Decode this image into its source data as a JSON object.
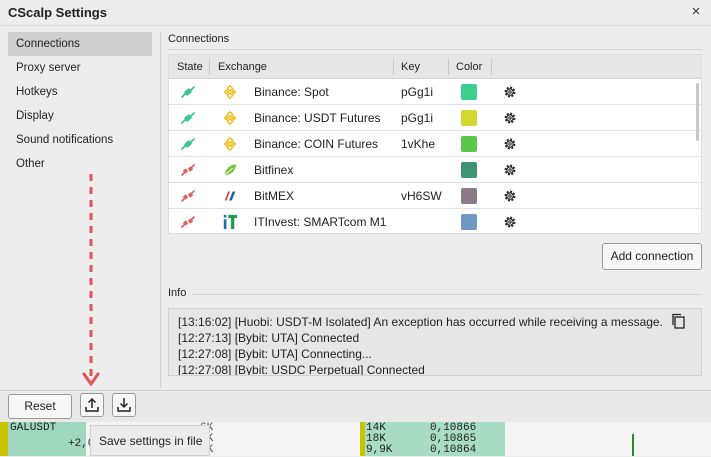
{
  "window": {
    "title": "CScalp Settings",
    "close_glyph": "×"
  },
  "sidebar": {
    "items": [
      {
        "label": "Connections",
        "active": true
      },
      {
        "label": "Proxy server",
        "active": false
      },
      {
        "label": "Hotkeys",
        "active": false
      },
      {
        "label": "Display",
        "active": false
      },
      {
        "label": "Sound notifications",
        "active": false
      },
      {
        "label": "Other",
        "active": false
      }
    ]
  },
  "connections": {
    "section_title": "Connections",
    "columns": [
      "State",
      "Exchange",
      "Key",
      "Color"
    ],
    "rows": [
      {
        "state": "connected",
        "exchange_icon": "binance-icon",
        "exchange": "Binance: Spot",
        "key": "pGg1i",
        "color": "#3cd08c"
      },
      {
        "state": "connected",
        "exchange_icon": "binance-icon",
        "exchange": "Binance: USDT Futures",
        "key": "pGg1i",
        "color": "#d6d632"
      },
      {
        "state": "connected",
        "exchange_icon": "binance-icon",
        "exchange": "Binance: COIN Futures",
        "key": "1vKhe",
        "color": "#56c846"
      },
      {
        "state": "disconnected",
        "exchange_icon": "bitfinex-leaf-icon",
        "exchange": "Bitfinex",
        "key": "",
        "color": "#3f9472"
      },
      {
        "state": "disconnected",
        "exchange_icon": "bitmex-icon",
        "exchange": "BitMEX",
        "key": "vH6SW",
        "color": "#8a7a88"
      },
      {
        "state": "disconnected",
        "exchange_icon": "itinvest-icon",
        "exchange": "ITInvest: SMARTcom M1",
        "key": "",
        "color": "#6f98c2"
      }
    ],
    "add_button_label": "Add connection"
  },
  "info": {
    "section_title": "Info",
    "lines": [
      "[13:16:02] [Huobi: USDT-M Isolated] An exception has occurred while receiving a message.",
      "[12:27:13] [Bybit: UTA] Connected",
      "[12:27:08] [Bybit: UTA] Connecting...",
      "[12:27:08] [Bybit: USDC Perpetual] Connected"
    ]
  },
  "footer": {
    "reset_label": "Reset",
    "upload_icon": "upload-icon",
    "download_icon": "download-icon",
    "tooltip": "Save settings in file"
  },
  "background": {
    "ticker": "GALUSDT",
    "value": "+2,0",
    "volumes": [
      "6K",
      "6K",
      "8K"
    ],
    "book": [
      {
        "size": "14K",
        "price": "0,10866"
      },
      {
        "size": "18K",
        "price": "0,10865"
      },
      {
        "size": "9,9K",
        "price": "0,10864"
      }
    ]
  },
  "colors": {
    "connected": "#3cc48a",
    "disconnected": "#e06060",
    "binance": "#f0b90b",
    "annotation_arrow": "#e05555"
  }
}
